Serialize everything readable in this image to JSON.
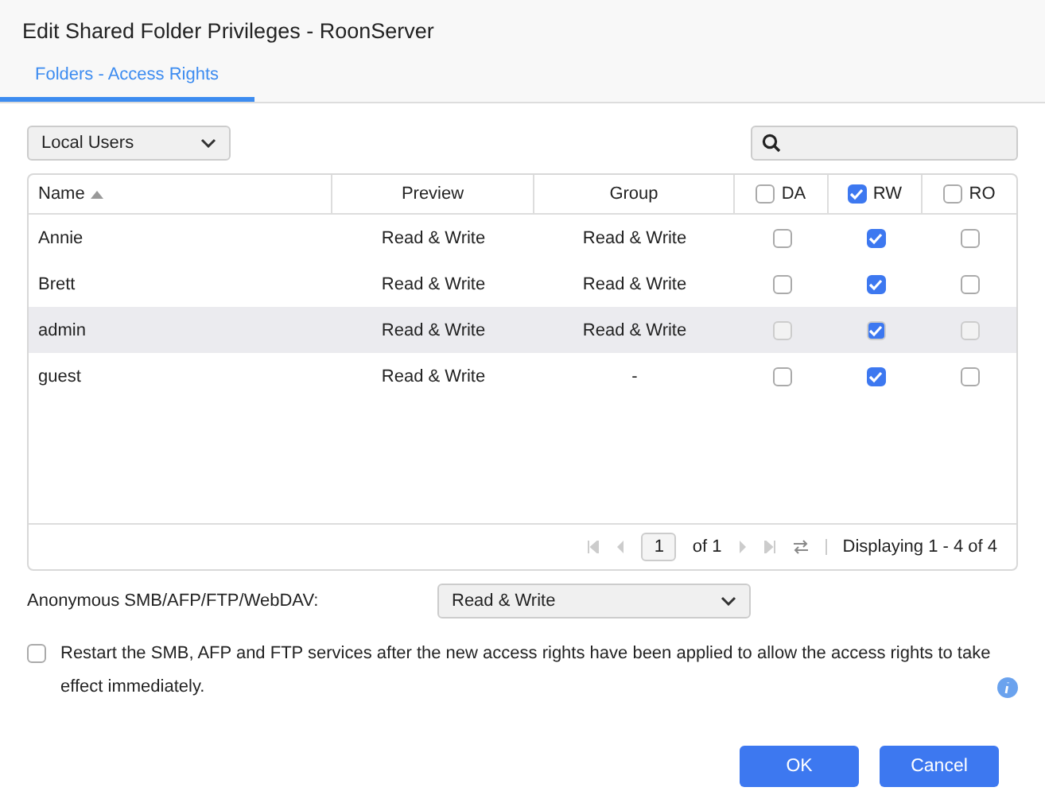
{
  "window": {
    "title": "Edit Shared Folder Privileges - RoonServer"
  },
  "tabs": [
    {
      "label": "Folders - Access Rights",
      "selected": true
    }
  ],
  "user_filter": {
    "value": "Local Users"
  },
  "table": {
    "columns": [
      {
        "label": "Name",
        "kind": "sort"
      },
      {
        "label": "Preview",
        "kind": "text"
      },
      {
        "label": "Group",
        "kind": "text"
      },
      {
        "label": "DA",
        "kind": "check",
        "checked": false
      },
      {
        "label": "RW",
        "kind": "check",
        "checked": true
      },
      {
        "label": "RO",
        "kind": "check",
        "checked": false
      }
    ],
    "rows": [
      {
        "name": "Annie",
        "preview": "Read & Write",
        "group": "Read & Write",
        "selected": false,
        "disabled": false,
        "da": false,
        "rw": true,
        "ro": false
      },
      {
        "name": "Brett",
        "preview": "Read & Write",
        "group": "Read & Write",
        "selected": false,
        "disabled": false,
        "da": false,
        "rw": true,
        "ro": false
      },
      {
        "name": "admin",
        "preview": "Read & Write",
        "group": "Read & Write",
        "selected": true,
        "disabled": true,
        "da": false,
        "rw": true,
        "ro": false
      },
      {
        "name": "guest",
        "preview": "Read & Write",
        "group": "-",
        "selected": false,
        "disabled": false,
        "da": false,
        "rw": true,
        "ro": false
      }
    ]
  },
  "pager": {
    "page": "1",
    "of": "of 1",
    "display": "Displaying 1 - 4 of 4"
  },
  "anonymous": {
    "label": "Anonymous SMB/AFP/FTP/WebDAV:",
    "value": "Read & Write"
  },
  "restart": {
    "checked": false,
    "text": "Restart the SMB, AFP and FTP services after the new access rights have been applied to allow the access rights to take effect immediately."
  },
  "buttons": [
    "OK",
    "Cancel"
  ]
}
